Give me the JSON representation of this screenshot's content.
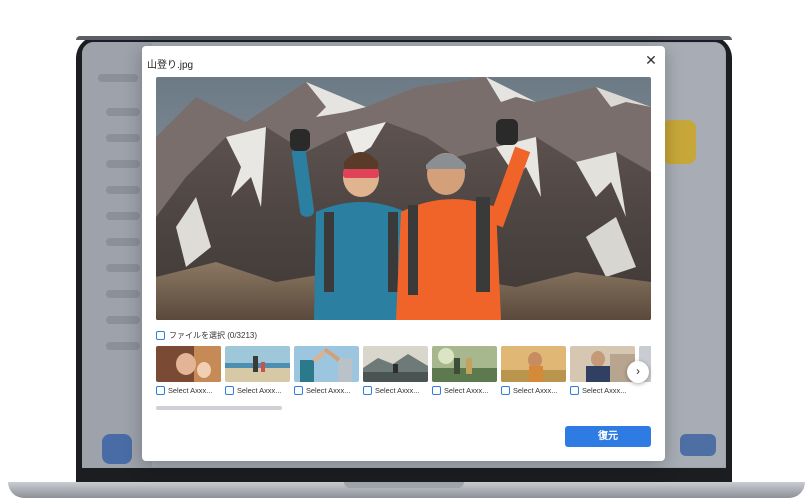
{
  "dialog": {
    "title": "山登り.jpg",
    "close_icon": "close-icon",
    "select_all_label": "ファイルを選択 (0/3213)",
    "restore_label": "復元",
    "next_icon": "chevron-right-icon"
  },
  "thumbnails": [
    {
      "label": "Select Axxx..."
    },
    {
      "label": "Select Axxx..."
    },
    {
      "label": "Select Axxx..."
    },
    {
      "label": "Select Axxx..."
    },
    {
      "label": "Select Axxx..."
    },
    {
      "label": "Select Axxx..."
    },
    {
      "label": "Select Axxx..."
    }
  ],
  "colors": {
    "accent": "#2e7be3",
    "checkbox_border": "#2f7de1"
  }
}
